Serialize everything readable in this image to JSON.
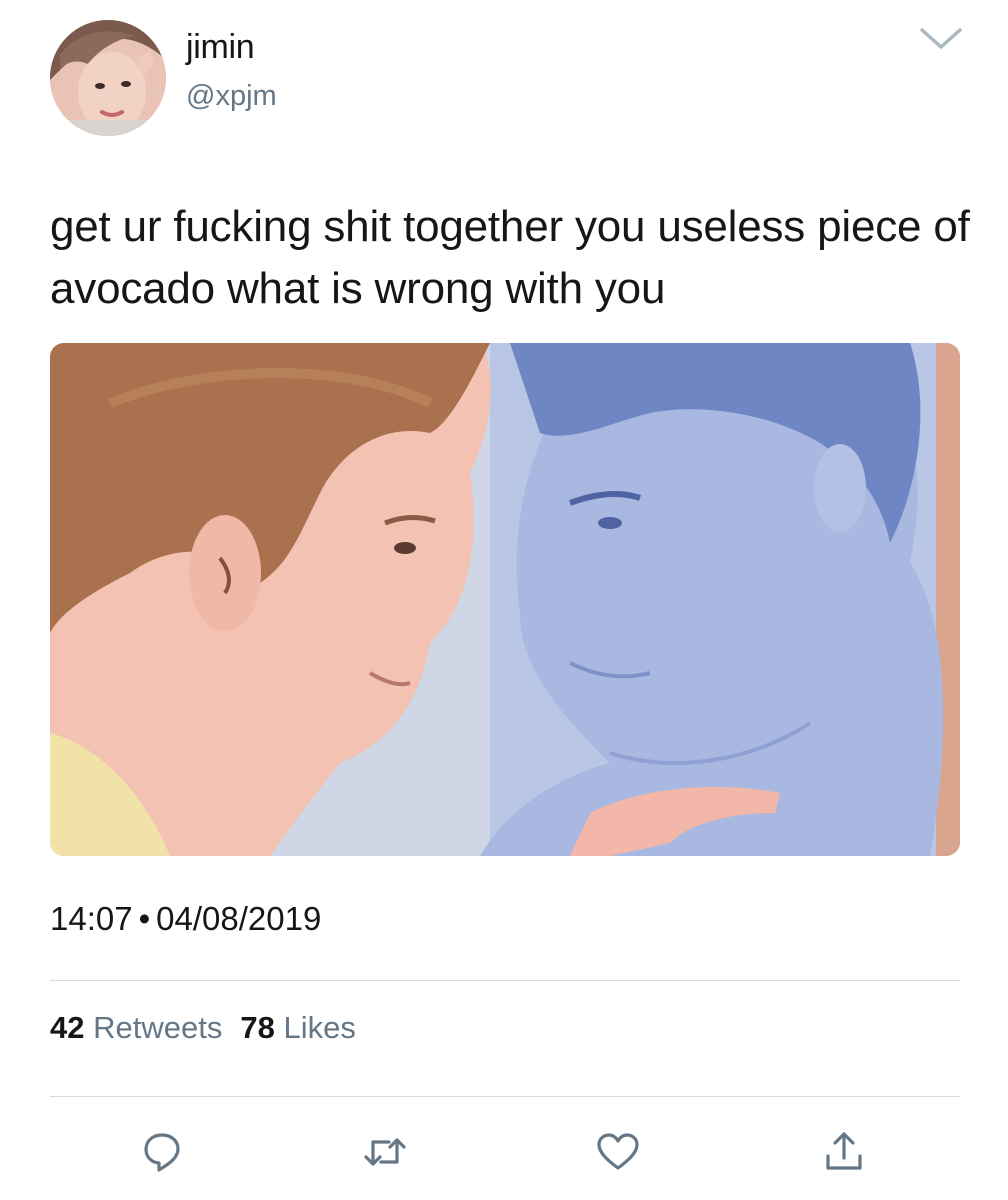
{
  "author": {
    "display_name": "jimin",
    "handle": "@xpjm",
    "avatar_icon": "profile-photo"
  },
  "menu_icon": "chevron-down-icon",
  "tweet": {
    "text": "get ur fucking shit together you useless piece of avocado what is wrong with you",
    "media_icon": "meme-illustration"
  },
  "meta": {
    "time": "14:07",
    "separator": "•",
    "date": "04/08/2019"
  },
  "stats": {
    "retweets_count": "42",
    "retweets_label": "Retweets",
    "likes_count": "78",
    "likes_label": "Likes"
  },
  "actions": [
    {
      "name": "reply",
      "icon": "reply-icon"
    },
    {
      "name": "retweet",
      "icon": "retweet-icon"
    },
    {
      "name": "like",
      "icon": "heart-icon"
    },
    {
      "name": "share",
      "icon": "share-icon"
    }
  ],
  "colors": {
    "text_primary": "#14171a",
    "text_secondary": "#657786",
    "icon": "#657786",
    "divider": "#d6dbe0"
  }
}
